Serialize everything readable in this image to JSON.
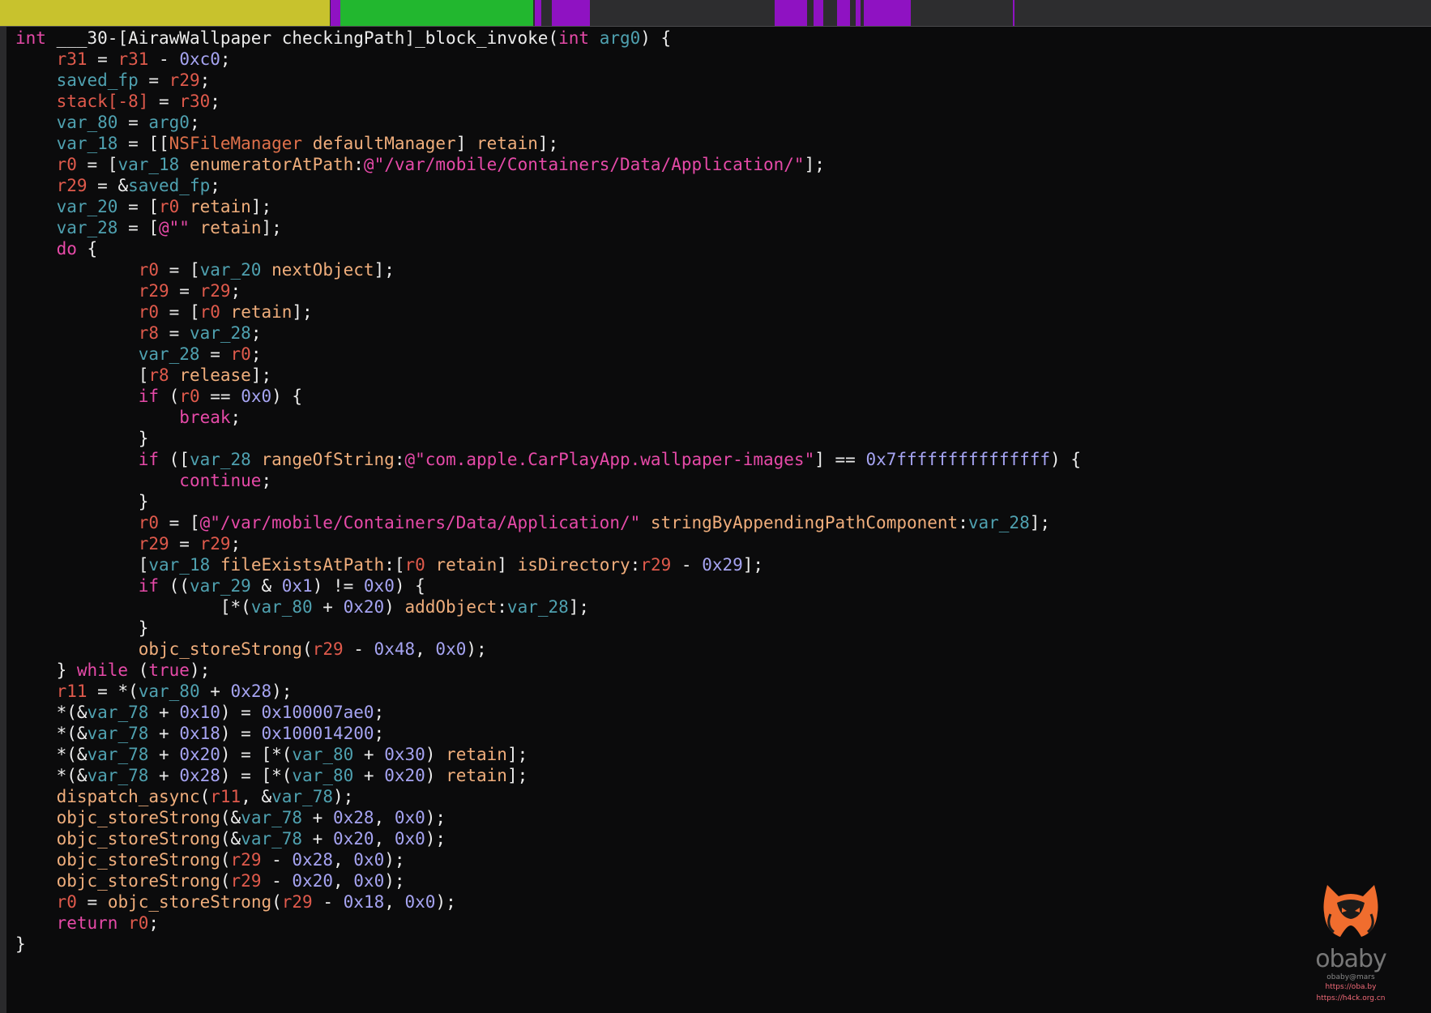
{
  "navigation_bar": {
    "segments": [
      {
        "color": "#c8c22d"
      },
      {
        "color": "#22b72f"
      },
      {
        "color": "#8f12c2"
      },
      {
        "color": "#2d2d2f"
      }
    ]
  },
  "code": {
    "lines": [
      [
        [
          "kw",
          "int"
        ],
        [
          "pl",
          " ___30-[AirawWallpaper checkingPath]_block_invoke("
        ],
        [
          "kw",
          "int"
        ],
        [
          "pl",
          " "
        ],
        [
          "var",
          "arg0"
        ],
        [
          "pl",
          ") {"
        ]
      ],
      [
        [
          "pl",
          "    "
        ],
        [
          "reg",
          "r31"
        ],
        [
          "pl",
          " = "
        ],
        [
          "reg",
          "r31"
        ],
        [
          "pl",
          " - "
        ],
        [
          "num",
          "0xc0"
        ],
        [
          "pl",
          ";"
        ]
      ],
      [
        [
          "pl",
          "    "
        ],
        [
          "var",
          "saved_fp"
        ],
        [
          "pl",
          " = "
        ],
        [
          "reg",
          "r29"
        ],
        [
          "pl",
          ";"
        ]
      ],
      [
        [
          "pl",
          "    "
        ],
        [
          "reg",
          "stack[-8]"
        ],
        [
          "pl",
          " = "
        ],
        [
          "reg",
          "r30"
        ],
        [
          "pl",
          ";"
        ]
      ],
      [
        [
          "pl",
          "    "
        ],
        [
          "var",
          "var_80"
        ],
        [
          "pl",
          " = "
        ],
        [
          "var",
          "arg0"
        ],
        [
          "pl",
          ";"
        ]
      ],
      [
        [
          "pl",
          "    "
        ],
        [
          "var",
          "var_18"
        ],
        [
          "pl",
          " = [["
        ],
        [
          "cls",
          "NSFileManager"
        ],
        [
          "pl",
          " "
        ],
        [
          "sel",
          "defaultManager"
        ],
        [
          "pl",
          "] "
        ],
        [
          "sel",
          "retain"
        ],
        [
          "pl",
          "];"
        ]
      ],
      [
        [
          "pl",
          "    "
        ],
        [
          "reg",
          "r0"
        ],
        [
          "pl",
          " = ["
        ],
        [
          "var",
          "var_18"
        ],
        [
          "pl",
          " "
        ],
        [
          "sel",
          "enumeratorAtPath"
        ],
        [
          "pl",
          ":"
        ],
        [
          "str",
          "@\"/var/mobile/Containers/Data/Application/\""
        ],
        [
          "pl",
          "];"
        ]
      ],
      [
        [
          "pl",
          "    "
        ],
        [
          "reg",
          "r29"
        ],
        [
          "pl",
          " = &"
        ],
        [
          "var",
          "saved_fp"
        ],
        [
          "pl",
          ";"
        ]
      ],
      [
        [
          "pl",
          "    "
        ],
        [
          "var",
          "var_20"
        ],
        [
          "pl",
          " = ["
        ],
        [
          "reg",
          "r0"
        ],
        [
          "pl",
          " "
        ],
        [
          "sel",
          "retain"
        ],
        [
          "pl",
          "];"
        ]
      ],
      [
        [
          "pl",
          "    "
        ],
        [
          "var",
          "var_28"
        ],
        [
          "pl",
          " = ["
        ],
        [
          "str",
          "@\"\""
        ],
        [
          "pl",
          " "
        ],
        [
          "sel",
          "retain"
        ],
        [
          "pl",
          "];"
        ]
      ],
      [
        [
          "pl",
          "    "
        ],
        [
          "kw",
          "do"
        ],
        [
          "pl",
          " {"
        ]
      ],
      [
        [
          "pl",
          "            "
        ],
        [
          "reg",
          "r0"
        ],
        [
          "pl",
          " = ["
        ],
        [
          "var",
          "var_20"
        ],
        [
          "pl",
          " "
        ],
        [
          "sel",
          "nextObject"
        ],
        [
          "pl",
          "];"
        ]
      ],
      [
        [
          "pl",
          "            "
        ],
        [
          "reg",
          "r29"
        ],
        [
          "pl",
          " = "
        ],
        [
          "reg",
          "r29"
        ],
        [
          "pl",
          ";"
        ]
      ],
      [
        [
          "pl",
          "            "
        ],
        [
          "reg",
          "r0"
        ],
        [
          "pl",
          " = ["
        ],
        [
          "reg",
          "r0"
        ],
        [
          "pl",
          " "
        ],
        [
          "sel",
          "retain"
        ],
        [
          "pl",
          "];"
        ]
      ],
      [
        [
          "pl",
          "            "
        ],
        [
          "reg",
          "r8"
        ],
        [
          "pl",
          " = "
        ],
        [
          "var",
          "var_28"
        ],
        [
          "pl",
          ";"
        ]
      ],
      [
        [
          "pl",
          "            "
        ],
        [
          "var",
          "var_28"
        ],
        [
          "pl",
          " = "
        ],
        [
          "reg",
          "r0"
        ],
        [
          "pl",
          ";"
        ]
      ],
      [
        [
          "pl",
          "            ["
        ],
        [
          "reg",
          "r8"
        ],
        [
          "pl",
          " "
        ],
        [
          "sel",
          "release"
        ],
        [
          "pl",
          "];"
        ]
      ],
      [
        [
          "pl",
          "            "
        ],
        [
          "kw",
          "if"
        ],
        [
          "pl",
          " ("
        ],
        [
          "reg",
          "r0"
        ],
        [
          "pl",
          " == "
        ],
        [
          "num",
          "0x0"
        ],
        [
          "pl",
          ") {"
        ]
      ],
      [
        [
          "pl",
          "                "
        ],
        [
          "kw",
          "break"
        ],
        [
          "pl",
          ";"
        ]
      ],
      [
        [
          "pl",
          "            }"
        ]
      ],
      [
        [
          "pl",
          "            "
        ],
        [
          "kw",
          "if"
        ],
        [
          "pl",
          " (["
        ],
        [
          "var",
          "var_28"
        ],
        [
          "pl",
          " "
        ],
        [
          "sel",
          "rangeOfString"
        ],
        [
          "pl",
          ":"
        ],
        [
          "str",
          "@\"com.apple.CarPlayApp.wallpaper-images\""
        ],
        [
          "pl",
          "] == "
        ],
        [
          "num",
          "0x7fffffffffffffff"
        ],
        [
          "pl",
          ") {"
        ]
      ],
      [
        [
          "pl",
          "                "
        ],
        [
          "kw",
          "continue"
        ],
        [
          "pl",
          ";"
        ]
      ],
      [
        [
          "pl",
          "            }"
        ]
      ],
      [
        [
          "pl",
          "            "
        ],
        [
          "reg",
          "r0"
        ],
        [
          "pl",
          " = ["
        ],
        [
          "str",
          "@\"/var/mobile/Containers/Data/Application/\""
        ],
        [
          "pl",
          " "
        ],
        [
          "sel",
          "stringByAppendingPathComponent"
        ],
        [
          "pl",
          ":"
        ],
        [
          "var",
          "var_28"
        ],
        [
          "pl",
          "];"
        ]
      ],
      [
        [
          "pl",
          "            "
        ],
        [
          "reg",
          "r29"
        ],
        [
          "pl",
          " = "
        ],
        [
          "reg",
          "r29"
        ],
        [
          "pl",
          ";"
        ]
      ],
      [
        [
          "pl",
          "            ["
        ],
        [
          "var",
          "var_18"
        ],
        [
          "pl",
          " "
        ],
        [
          "sel",
          "fileExistsAtPath"
        ],
        [
          "pl",
          ":["
        ],
        [
          "reg",
          "r0"
        ],
        [
          "pl",
          " "
        ],
        [
          "sel",
          "retain"
        ],
        [
          "pl",
          "] "
        ],
        [
          "sel",
          "isDirectory"
        ],
        [
          "pl",
          ":"
        ],
        [
          "reg",
          "r29"
        ],
        [
          "pl",
          " - "
        ],
        [
          "num",
          "0x29"
        ],
        [
          "pl",
          "];"
        ]
      ],
      [
        [
          "pl",
          "            "
        ],
        [
          "kw",
          "if"
        ],
        [
          "pl",
          " (("
        ],
        [
          "var",
          "var_29"
        ],
        [
          "pl",
          " & "
        ],
        [
          "num",
          "0x1"
        ],
        [
          "pl",
          ") != "
        ],
        [
          "num",
          "0x0"
        ],
        [
          "pl",
          ") {"
        ]
      ],
      [
        [
          "pl",
          "                    [*("
        ],
        [
          "var",
          "var_80"
        ],
        [
          "pl",
          " + "
        ],
        [
          "num",
          "0x20"
        ],
        [
          "pl",
          ") "
        ],
        [
          "sel",
          "addObject"
        ],
        [
          "pl",
          ":"
        ],
        [
          "var",
          "var_28"
        ],
        [
          "pl",
          "];"
        ]
      ],
      [
        [
          "pl",
          "            }"
        ]
      ],
      [
        [
          "pl",
          "            "
        ],
        [
          "fn",
          "objc_storeStrong"
        ],
        [
          "pl",
          "("
        ],
        [
          "reg",
          "r29"
        ],
        [
          "pl",
          " - "
        ],
        [
          "num",
          "0x48"
        ],
        [
          "pl",
          ", "
        ],
        [
          "num",
          "0x0"
        ],
        [
          "pl",
          ");"
        ]
      ],
      [
        [
          "pl",
          "    } "
        ],
        [
          "kw",
          "while"
        ],
        [
          "pl",
          " ("
        ],
        [
          "kw",
          "true"
        ],
        [
          "pl",
          ");"
        ]
      ],
      [
        [
          "pl",
          "    "
        ],
        [
          "reg",
          "r11"
        ],
        [
          "pl",
          " = *("
        ],
        [
          "var",
          "var_80"
        ],
        [
          "pl",
          " + "
        ],
        [
          "num",
          "0x28"
        ],
        [
          "pl",
          ");"
        ]
      ],
      [
        [
          "pl",
          "    *(&"
        ],
        [
          "var",
          "var_78"
        ],
        [
          "pl",
          " + "
        ],
        [
          "num",
          "0x10"
        ],
        [
          "pl",
          ") = "
        ],
        [
          "num",
          "0x100007ae0"
        ],
        [
          "pl",
          ";"
        ]
      ],
      [
        [
          "pl",
          "    *(&"
        ],
        [
          "var",
          "var_78"
        ],
        [
          "pl",
          " + "
        ],
        [
          "num",
          "0x18"
        ],
        [
          "pl",
          ") = "
        ],
        [
          "num",
          "0x100014200"
        ],
        [
          "pl",
          ";"
        ]
      ],
      [
        [
          "pl",
          "    *(&"
        ],
        [
          "var",
          "var_78"
        ],
        [
          "pl",
          " + "
        ],
        [
          "num",
          "0x20"
        ],
        [
          "pl",
          ") = [*("
        ],
        [
          "var",
          "var_80"
        ],
        [
          "pl",
          " + "
        ],
        [
          "num",
          "0x30"
        ],
        [
          "pl",
          ") "
        ],
        [
          "sel",
          "retain"
        ],
        [
          "pl",
          "];"
        ]
      ],
      [
        [
          "pl",
          "    *(&"
        ],
        [
          "var",
          "var_78"
        ],
        [
          "pl",
          " + "
        ],
        [
          "num",
          "0x28"
        ],
        [
          "pl",
          ") = [*("
        ],
        [
          "var",
          "var_80"
        ],
        [
          "pl",
          " + "
        ],
        [
          "num",
          "0x20"
        ],
        [
          "pl",
          ") "
        ],
        [
          "sel",
          "retain"
        ],
        [
          "pl",
          "];"
        ]
      ],
      [
        [
          "pl",
          "    "
        ],
        [
          "fn",
          "dispatch_async"
        ],
        [
          "pl",
          "("
        ],
        [
          "reg",
          "r11"
        ],
        [
          "pl",
          ", &"
        ],
        [
          "var",
          "var_78"
        ],
        [
          "pl",
          ");"
        ]
      ],
      [
        [
          "pl",
          "    "
        ],
        [
          "fn",
          "objc_storeStrong"
        ],
        [
          "pl",
          "(&"
        ],
        [
          "var",
          "var_78"
        ],
        [
          "pl",
          " + "
        ],
        [
          "num",
          "0x28"
        ],
        [
          "pl",
          ", "
        ],
        [
          "num",
          "0x0"
        ],
        [
          "pl",
          ");"
        ]
      ],
      [
        [
          "pl",
          "    "
        ],
        [
          "fn",
          "objc_storeStrong"
        ],
        [
          "pl",
          "(&"
        ],
        [
          "var",
          "var_78"
        ],
        [
          "pl",
          " + "
        ],
        [
          "num",
          "0x20"
        ],
        [
          "pl",
          ", "
        ],
        [
          "num",
          "0x0"
        ],
        [
          "pl",
          ");"
        ]
      ],
      [
        [
          "pl",
          "    "
        ],
        [
          "fn",
          "objc_storeStrong"
        ],
        [
          "pl",
          "("
        ],
        [
          "reg",
          "r29"
        ],
        [
          "pl",
          " - "
        ],
        [
          "num",
          "0x28"
        ],
        [
          "pl",
          ", "
        ],
        [
          "num",
          "0x0"
        ],
        [
          "pl",
          ");"
        ]
      ],
      [
        [
          "pl",
          "    "
        ],
        [
          "fn",
          "objc_storeStrong"
        ],
        [
          "pl",
          "("
        ],
        [
          "reg",
          "r29"
        ],
        [
          "pl",
          " - "
        ],
        [
          "num",
          "0x20"
        ],
        [
          "pl",
          ", "
        ],
        [
          "num",
          "0x0"
        ],
        [
          "pl",
          ");"
        ]
      ],
      [
        [
          "pl",
          "    "
        ],
        [
          "reg",
          "r0"
        ],
        [
          "pl",
          " = "
        ],
        [
          "fn",
          "objc_storeStrong"
        ],
        [
          "pl",
          "("
        ],
        [
          "reg",
          "r29"
        ],
        [
          "pl",
          " - "
        ],
        [
          "num",
          "0x18"
        ],
        [
          "pl",
          ", "
        ],
        [
          "num",
          "0x0"
        ],
        [
          "pl",
          ");"
        ]
      ],
      [
        [
          "pl",
          "    "
        ],
        [
          "kw",
          "return"
        ],
        [
          "pl",
          " "
        ],
        [
          "reg",
          "r0"
        ],
        [
          "pl",
          ";"
        ]
      ],
      [
        [
          "pl",
          "}"
        ]
      ]
    ]
  },
  "watermark": {
    "name": "obaby",
    "handle": "obaby@mars",
    "url1": "https://oba.by",
    "url2": "https://h4ck.org.cn",
    "colors": {
      "logo": "#f06d2e",
      "url": "#f06a78"
    }
  }
}
